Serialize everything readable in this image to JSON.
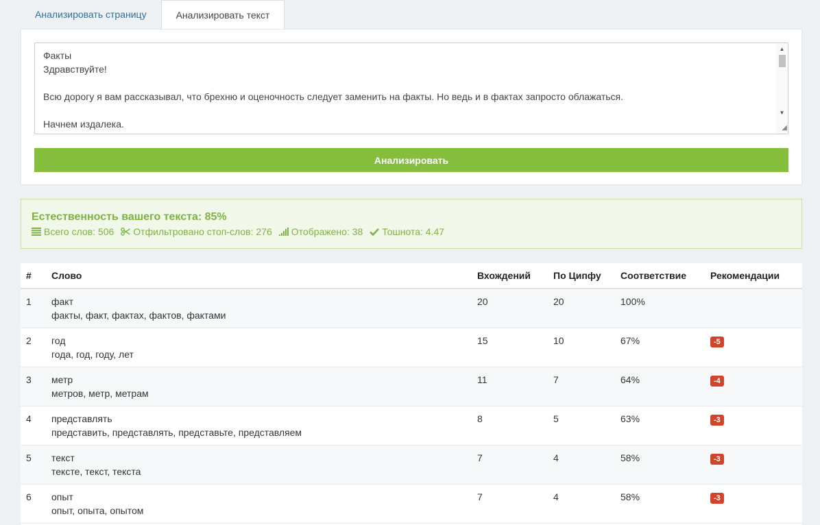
{
  "tabs": [
    {
      "label": "Анализировать страницу",
      "active": false
    },
    {
      "label": "Анализировать текст",
      "active": true
    }
  ],
  "input": {
    "text": "Факты\nЗдравствуйте!\n\nВсю дорогу я вам рассказывал, что брехню и оценочность следует заменить на факты. Но ведь и в фактах запросто облажаться.\n\nНачнем издалека."
  },
  "analyze_button": "Анализировать",
  "summary": {
    "title": "Естественность вашего текста: 85%",
    "total_words": "Всего слов: 506",
    "filtered_stopwords": "Отфильтровано стоп-слов: 276",
    "shown": "Отображено: 38",
    "nausea": "Тошнота: 4.47"
  },
  "table": {
    "headers": {
      "num": "#",
      "word": "Слово",
      "occurrences": "Вхождений",
      "zipf": "По Ципфу",
      "match": "Соответствие",
      "recommendations": "Рекомендации"
    },
    "rows": [
      {
        "num": "1",
        "word": "факт",
        "forms": "факты, факт, фактах, фактов, фактами",
        "occurrences": "20",
        "zipf": "20",
        "match": "100%",
        "rec": ""
      },
      {
        "num": "2",
        "word": "год",
        "forms": "года, год, году, лет",
        "occurrences": "15",
        "zipf": "10",
        "match": "67%",
        "rec": "-5"
      },
      {
        "num": "3",
        "word": "метр",
        "forms": "метров, метр, метрам",
        "occurrences": "11",
        "zipf": "7",
        "match": "64%",
        "rec": "-4"
      },
      {
        "num": "4",
        "word": "представлять",
        "forms": "представить, представлять, представьте, представляем",
        "occurrences": "8",
        "zipf": "5",
        "match": "63%",
        "rec": "-3"
      },
      {
        "num": "5",
        "word": "текст",
        "forms": "тексте, текст, текста",
        "occurrences": "7",
        "zipf": "4",
        "match": "58%",
        "rec": "-3"
      },
      {
        "num": "6",
        "word": "опыт",
        "forms": "опыт, опыта, опытом",
        "occurrences": "7",
        "zipf": "4",
        "match": "58%",
        "rec": "-3"
      }
    ]
  },
  "colors": {
    "accent_green": "#85bd3c",
    "summary_text": "#7cb342",
    "badge_red": "#d0442c",
    "tab_link": "#2f6f9e"
  },
  "icons": {
    "total_words": "list-icon",
    "filtered": "scissors-icon",
    "shown": "signal-bars-icon",
    "nausea": "check-icon"
  }
}
